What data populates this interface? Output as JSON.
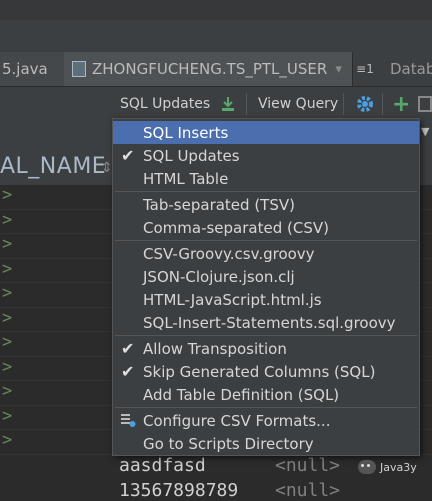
{
  "tabs": [
    {
      "label": "5.java"
    },
    {
      "label": "ZHONGFUCHENG.TS_PTL_USER",
      "close": "▾"
    },
    {
      "label": "≡1"
    },
    {
      "label": "Databa"
    }
  ],
  "toolbar": {
    "sql_updates_label": "SQL Updates",
    "view_query_label": "View Query",
    "add_symbol": "+"
  },
  "column_header": {
    "name": "AL_NAME",
    "sorter": "⇕"
  },
  "rows": [
    ">",
    ">",
    ">",
    ">",
    ">",
    ">",
    ">",
    ">",
    ">",
    ">",
    ">"
  ],
  "menu": {
    "items": [
      {
        "label": "SQL Inserts",
        "selected": true,
        "check": false
      },
      {
        "label": "SQL Updates",
        "check": true
      },
      {
        "label": "HTML Table",
        "check": false
      },
      {
        "label": "Tab-separated (TSV)",
        "check": false
      },
      {
        "label": "Comma-separated (CSV)",
        "check": false
      },
      {
        "label": "CSV-Groovy.csv.groovy",
        "check": false
      },
      {
        "label": "JSON-Clojure.json.clj",
        "check": false
      },
      {
        "label": "HTML-JavaScript.html.js",
        "check": false
      },
      {
        "label": "SQL-Insert-Statements.sql.groovy",
        "check": false
      },
      {
        "label": "Allow Transposition",
        "check": true
      },
      {
        "label": "Skip Generated Columns (SQL)",
        "check": true
      },
      {
        "label": "Add Table Definition (SQL)",
        "check": false
      },
      {
        "label": "Configure CSV Formats...",
        "icon": "table-settings-icon"
      },
      {
        "label": "Go to Scripts Directory",
        "check": false
      }
    ],
    "check_glyph": "✔"
  },
  "bottom_cells": {
    "value1": "aasdfasd",
    "null1": "<null>",
    "value2": "13567898789",
    "null2": "<null>"
  },
  "watermark": {
    "label": "Java3y"
  },
  "colors": {
    "selection": "#4b6eaf",
    "background": "#2b2b2b",
    "menu": "#3c3f41"
  }
}
